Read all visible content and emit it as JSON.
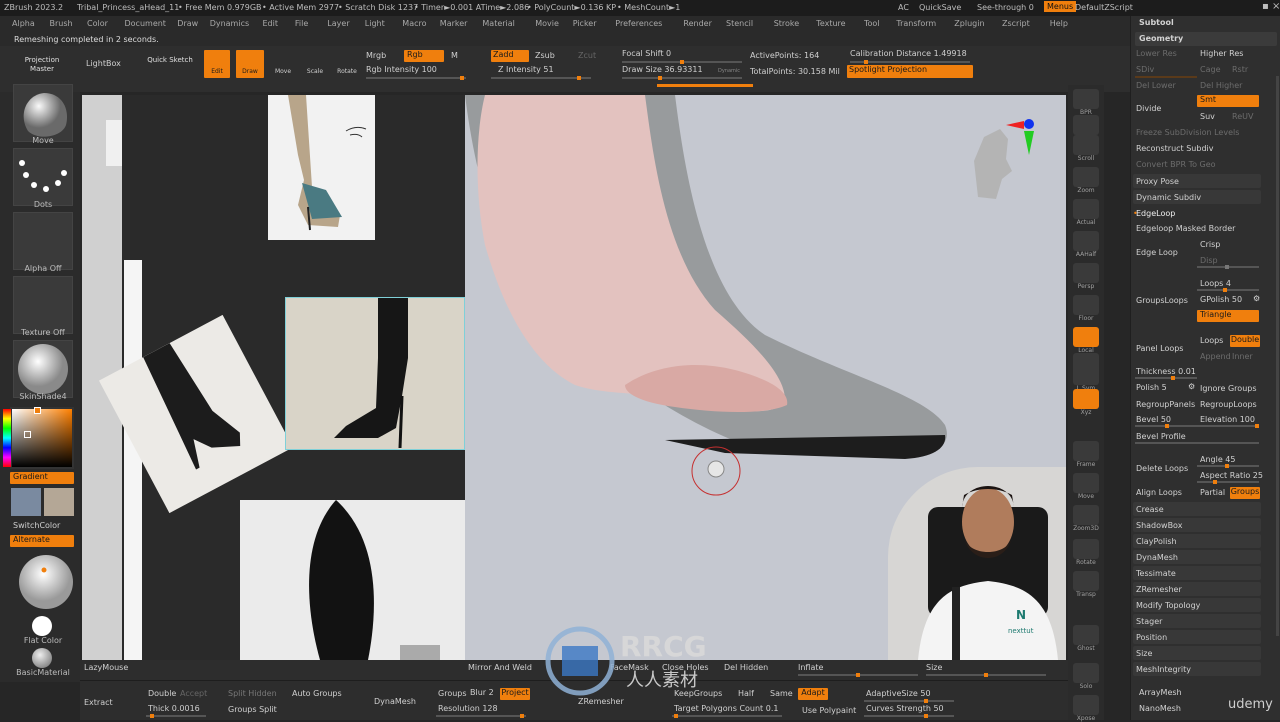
{
  "titlebar": {
    "app": "ZBrush 2023.2",
    "project": "Tribal_Princess_aHead_11",
    "free_mem": "• Free Mem 0.979GB",
    "active_mem": "• Active Mem 2977",
    "scratch": "• Scratch Disk 1237",
    "timer": "• Timer►0.001 ATime►2.086",
    "poly": "• PolyCount►0.136 KP",
    "mesh": "• MeshCount►1",
    "ac": "AC",
    "quicksave": "QuickSave",
    "seethrough": "See-through 0",
    "menus": "Menus",
    "default_script": "DefaultZScript"
  },
  "menubar": [
    "Alpha",
    "Brush",
    "Color",
    "Document",
    "Draw",
    "Dynamics",
    "Edit",
    "File",
    "Layer",
    "Light",
    "Macro",
    "Marker",
    "Material",
    "Movie",
    "Picker",
    "Preferences",
    "Render",
    "Stencil",
    "Stroke",
    "Texture",
    "Tool",
    "Transform",
    "Zplugin",
    "Zscript",
    "Help"
  ],
  "status": "Remeshing completed in 2 seconds.",
  "shelf": {
    "projection_master": "Projection Master",
    "lightbox": "LightBox",
    "quick_sketch": "Quick Sketch",
    "edit": "Edit",
    "draw": "Draw",
    "move": "Move",
    "scale": "Scale",
    "rotate": "Rotate",
    "mrgb": "Mrgb",
    "rgb": "Rgb",
    "m": "M",
    "rgb_intensity": "Rgb Intensity 100",
    "zadd": "Zadd",
    "zsub": "Zsub",
    "zcut": "Zcut",
    "z_intensity": "Z Intensity 51",
    "focal_shift": "Focal Shift 0",
    "draw_size": "Draw Size 36.93311",
    "dynamic": "Dynamic",
    "active_points": "ActivePoints: 164",
    "total_points": "TotalPoints: 30.158 Mil",
    "calibration": "Calibration Distance 1.49918",
    "spotlight": "Spotlight Projection"
  },
  "leftshelf": {
    "move": "Move",
    "dots": "Dots",
    "alpha_off": "Alpha Off",
    "texture_off": "Texture Off",
    "skinshade": "SkinShade4",
    "gradient": "Gradient",
    "switchcolor": "SwitchColor",
    "alternate": "Alternate",
    "flat_color": "Flat Color",
    "basic_material": "BasicMaterial"
  },
  "rightshelf": {
    "bpr": "BPR",
    "spix": "SPix 3",
    "scroll": "Scroll",
    "zoom": "Zoom",
    "actual": "Actual",
    "aahalf": "AAHalf",
    "persp": "Persp",
    "floor": "Floor",
    "local": "Local",
    "dynamic": "Dynamic",
    "lsym": "L.Sym",
    "xyz": "Xyz",
    "frame": "Frame",
    "move": "Move",
    "zoom3d": "Zoom3D",
    "rotate": "Rotate",
    "transp": "Transp",
    "ghost": "Ghost",
    "solo": "Solo",
    "xpose": "Xpose"
  },
  "panel": {
    "subtool": "Subtool",
    "geometry": "Geometry",
    "lower_res": "Lower Res",
    "higher_res": "Higher Res",
    "sdiv": "SDiv",
    "cage": "Cage",
    "rstr": "Rstr",
    "del_lower": "Del Lower",
    "del_higher": "Del Higher",
    "divide": "Divide",
    "smt": "Smt",
    "suv": "Suv",
    "reuv": "ReUV",
    "freeze": "Freeze SubDivision Levels",
    "reconstruct": "Reconstruct Subdiv",
    "convert_bpr": "Convert BPR To Geo",
    "proxy_pose": "Proxy Pose",
    "dynamic_subdiv": "Dynamic Subdiv",
    "edgeloop": "EdgeLoop",
    "edgeloop_masked": "Edgeloop Masked Border",
    "edge_loop": "Edge Loop",
    "crisp": "Crisp",
    "disp": "Disp",
    "loops": "Loops 4",
    "groupsloops": "GroupsLoops",
    "gpolish": "GPolish 50",
    "triangle": "Triangle",
    "panel_loops": "Panel Loops",
    "loops2": "Loops",
    "double": "Double",
    "append": "Append",
    "inner": "Inner",
    "thickness": "Thickness 0.01",
    "polish": "Polish 5",
    "ignore_groups": "Ignore Groups",
    "regroup_panels": "RegroupPanels",
    "regroup_loops": "RegroupLoops",
    "bevel": "Bevel 50",
    "elevation": "Elevation 100",
    "bevel_profile": "Bevel Profile",
    "delete_loops": "Delete Loops",
    "angle": "Angle 45",
    "aspect": "Aspect Ratio 25",
    "align_loops": "Align Loops",
    "partial": "Partial",
    "groups": "Groups",
    "crease": "Crease",
    "shadowbox": "ShadowBox",
    "claypolish": "ClayPolish",
    "dynamesh": "DynaMesh",
    "tessimate": "Tessimate",
    "zremesher": "ZRemesher",
    "modify_topology": "Modify Topology",
    "stager": "Stager",
    "position": "Position",
    "size": "Size",
    "meshintegrity": "MeshIntegrity",
    "arraymesh": "ArrayMesh",
    "nanomesh": "NanoMesh"
  },
  "bottom": {
    "lazymouse": "LazyMouse",
    "mirror_weld": "Mirror And Weld",
    "facemask": "FaceMask",
    "close_holes": "Close Holes",
    "del_hidden": "Del Hidden",
    "inflate": "Inflate",
    "size": "Size",
    "extract": "Extract",
    "double": "Double",
    "accept": "Accept",
    "thick": "Thick 0.0016",
    "split_hidden": "Split Hidden",
    "groups_split": "Groups Split",
    "auto_groups": "Auto Groups",
    "dynamesh": "DynaMesh",
    "groups": "Groups",
    "blur": "Blur 2",
    "project": "Project",
    "resolution": "Resolution 128",
    "zremesher": "ZRemesher",
    "keepgroups": "KeepGroups",
    "half": "Half",
    "same": "Same",
    "adapt": "Adapt",
    "target_polys": "Target Polygons Count 0.1",
    "use_polypaint": "Use Polypaint",
    "adaptive_size": "AdaptiveSize 50",
    "curves_strength": "Curves Strength 50"
  },
  "presenter": {
    "shirt_text": "nexttut"
  },
  "watermark": {
    "brand": "RRCG",
    "sub": "人人素材",
    "udemy": "udemy"
  },
  "colors": {
    "accent": "#f07f0d",
    "panel": "#2f2f2f",
    "canvas": "#c5c8d0"
  }
}
